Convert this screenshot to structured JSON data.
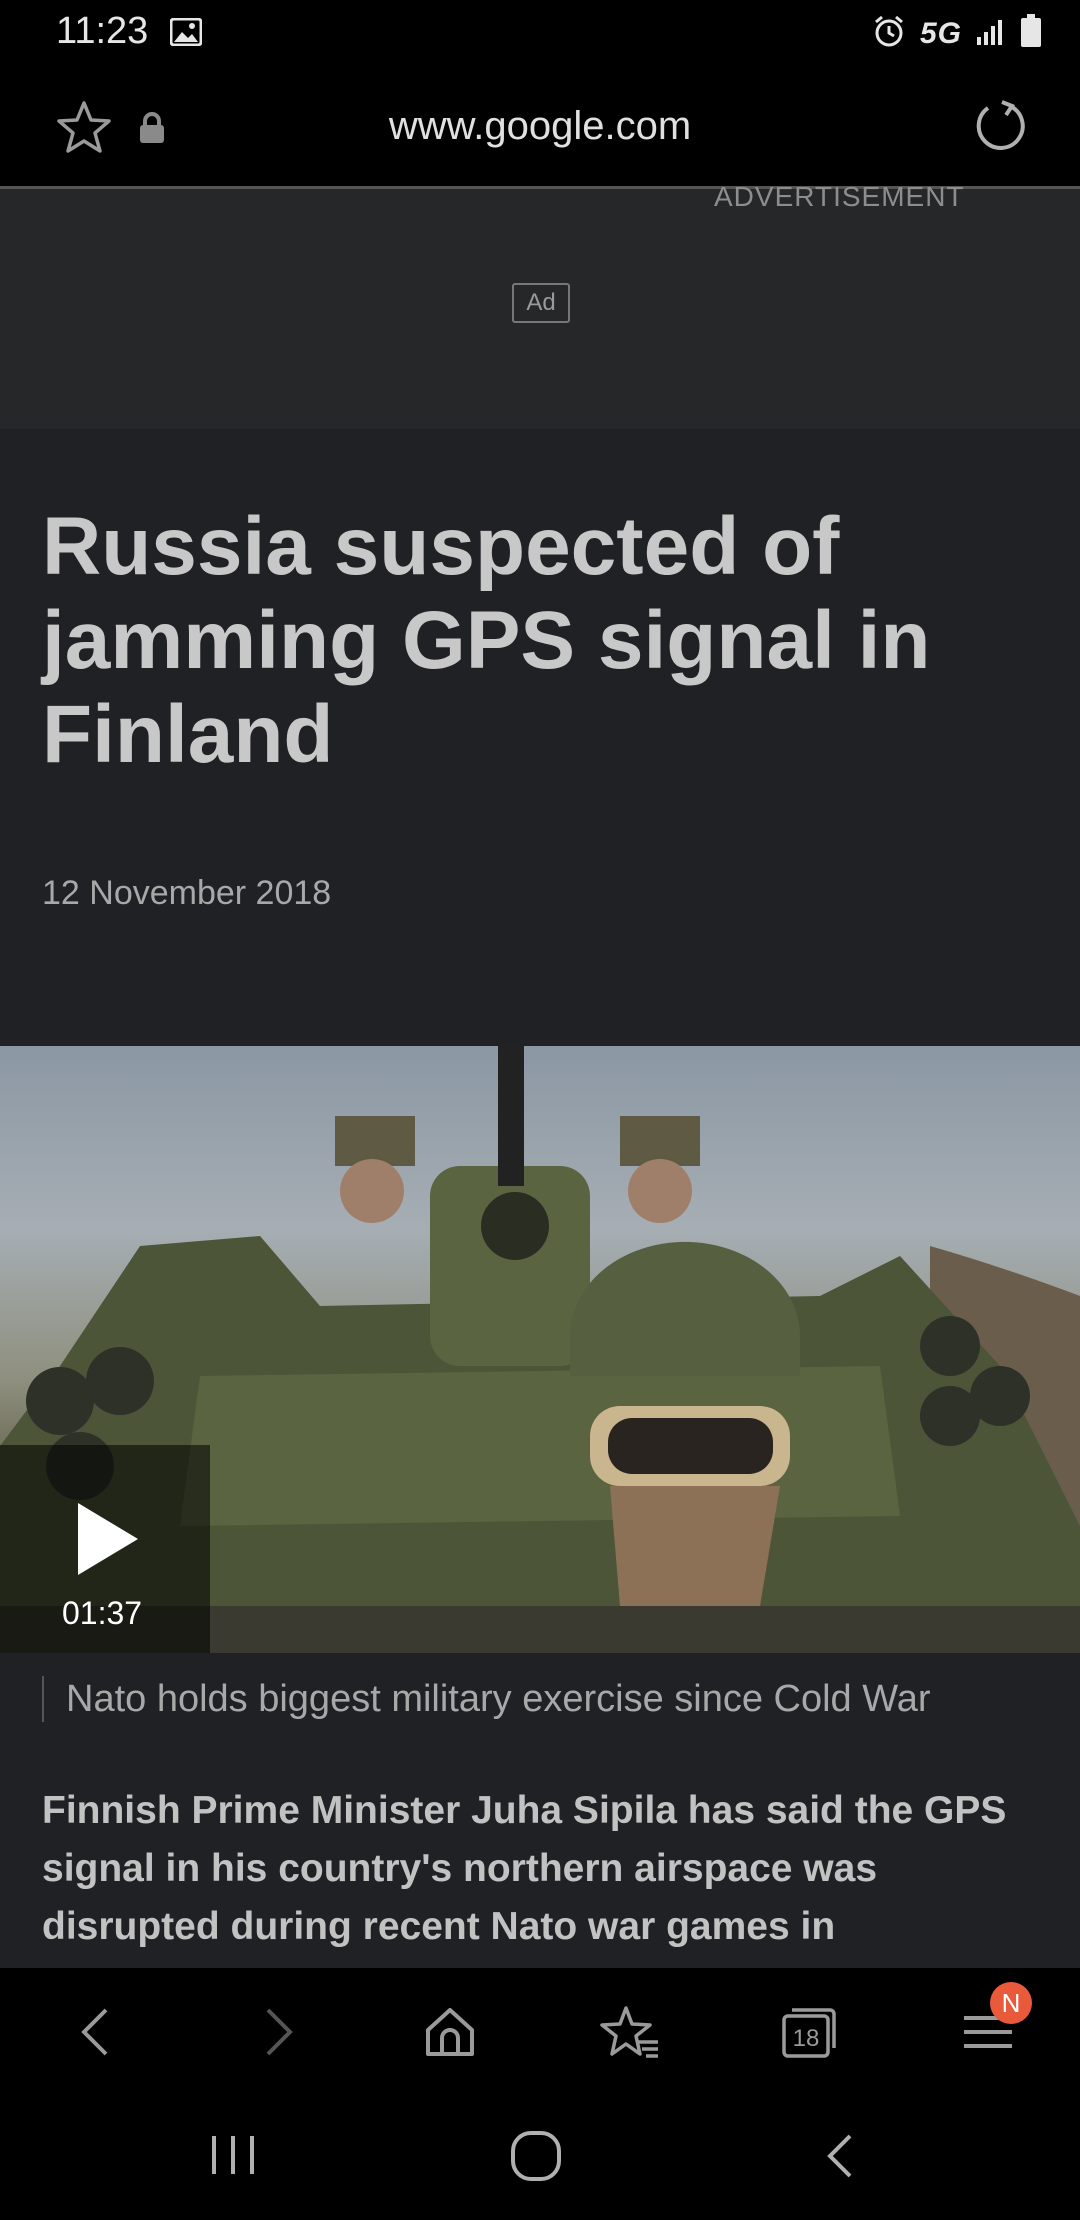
{
  "status_bar": {
    "time": "11:23",
    "network": "5G",
    "icons": [
      "gallery-icon",
      "alarm-icon",
      "signal-icon",
      "battery-icon"
    ]
  },
  "url_bar": {
    "url": "www.google.com",
    "icons": [
      "star-icon",
      "lock-icon",
      "reload-icon"
    ]
  },
  "ad": {
    "label": "ADVERTISEMENT",
    "badge": "Ad"
  },
  "article": {
    "headline": "Russia suspected of jamming GPS signal in Finland",
    "date": "12 November 2018",
    "video": {
      "duration": "01:37",
      "caption": "Nato holds biggest military exercise since Cold War"
    },
    "body": "Finnish Prime Minister Juha Sipila has said the GPS signal in his country's northern airspace was disrupted during recent Nato war games in"
  },
  "browser_nav": {
    "tabs_count": "18",
    "notification_badge": "N",
    "icons": [
      "back-icon",
      "forward-icon",
      "home-icon",
      "bookmarks-icon",
      "tabs-icon",
      "menu-icon"
    ]
  },
  "system_nav": {
    "icons": [
      "recent-apps-icon",
      "home-circle-icon",
      "system-back-icon"
    ]
  },
  "colors": {
    "page_bg": "#202124",
    "bar_bg": "#000000",
    "badge": "#e85a3a"
  }
}
